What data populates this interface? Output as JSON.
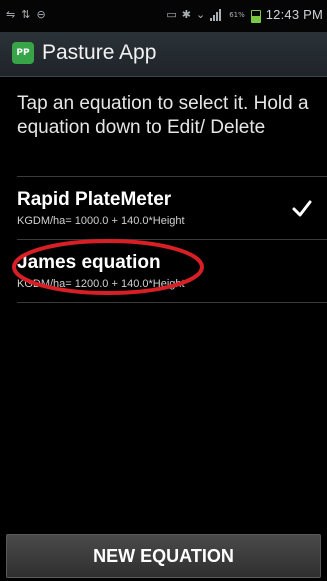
{
  "status_bar": {
    "time": "12:43 PM",
    "battery_text": "61%",
    "left_icons": [
      "usb-icon",
      "transfer-icon",
      "sync-icon"
    ],
    "right_icons": [
      "nfc-icon",
      "bluetooth-icon",
      "wifi-icon",
      "signal-icon",
      "battery-icon"
    ]
  },
  "app_bar": {
    "logo_text": "PP",
    "title": "Pasture App",
    "logo_color": "#37a447"
  },
  "instructions": "Tap an equation to select it. Hold a equation down to Edit/ Delete",
  "equations": [
    {
      "name": "Rapid PlateMeter",
      "formula": "KGDM/ha= 1000.0 + 140.0*Height",
      "selected": true
    },
    {
      "name": "James equation",
      "formula": "KGDM/ha= 1200.0 + 140.0*Height",
      "selected": false
    }
  ],
  "annotation": {
    "highlight_color": "#d81f26",
    "highlighted_item": "James equation"
  },
  "new_button_label": "NEW EQUATION"
}
